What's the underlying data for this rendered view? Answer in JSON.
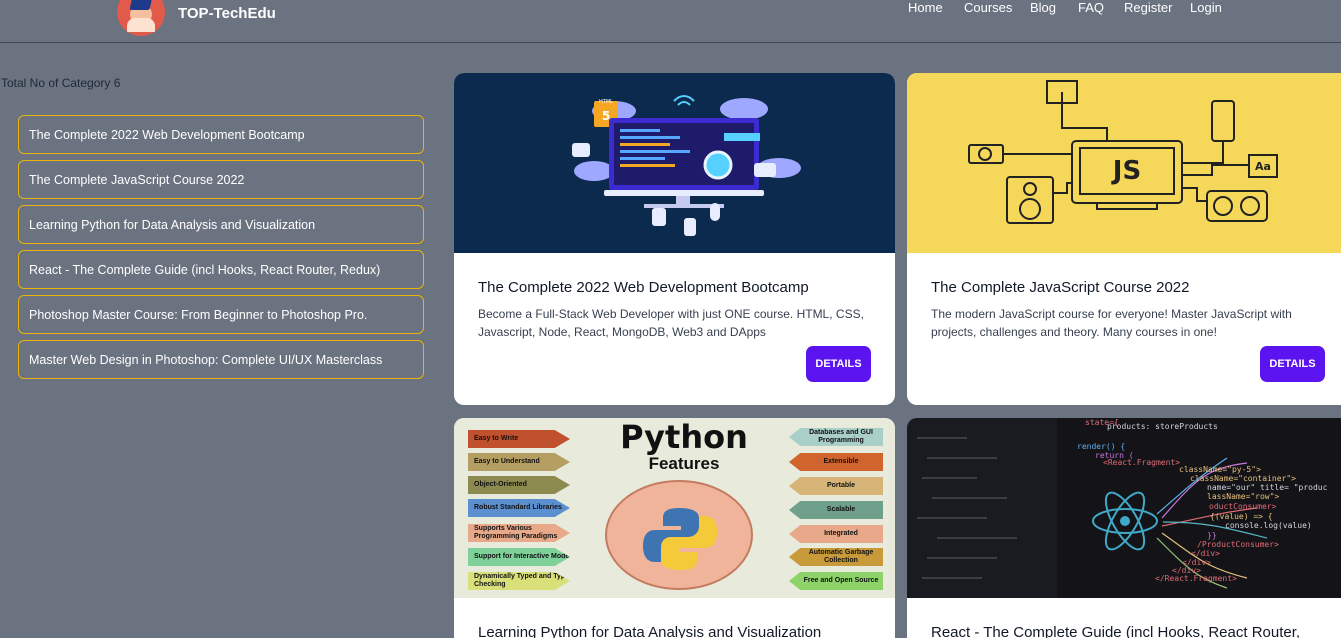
{
  "navbar": {
    "brand": "TOP-TechEdu",
    "links": [
      "Home",
      "Courses",
      "Blog",
      "FAQ",
      "Register",
      "Login"
    ]
  },
  "sidebar": {
    "count_label": "Total No of Category 6",
    "categories": [
      "The Complete 2022 Web Development Bootcamp",
      "The Complete JavaScript Course 2022",
      "Learning Python for Data Analysis and Visualization",
      "React - The Complete Guide (incl Hooks, React Router, Redux)",
      "Photoshop Master Course: From Beginner to Photoshop Pro.",
      "Master Web Design in Photoshop: Complete UI/UX Masterclass"
    ]
  },
  "cards": [
    {
      "title": "The Complete 2022 Web Development Bootcamp",
      "description": "Become a Full-Stack Web Developer with just ONE course. HTML, CSS, Javascript, Node, React, MongoDB, Web3 and DApps",
      "button": "DETAILS",
      "image_label": "HTML",
      "image_badge": "5"
    },
    {
      "title": "The Complete JavaScript Course 2022",
      "description": "The modern JavaScript course for everyone! Master JavaScript with projects, challenges and theory. Many courses in one!",
      "button": "DETAILS",
      "image_label": "JS",
      "image_badge": "Aa"
    },
    {
      "title": "Learning Python for Data Analysis and Visualization",
      "image_title": "Python",
      "image_subtitle": "Features",
      "features_left": [
        "Easy to Write",
        "Easy to Understand",
        "Object-Oriented",
        "Robust Standard Libraries",
        "Supports Various Programming Paradigms",
        "Support for Interactive Mode",
        "Dynamically Typed and Type Checking"
      ],
      "features_right": [
        "Databases and GUI Programming",
        "Extensible",
        "Portable",
        "Scalable",
        "Integrated",
        "Automatic Garbage Collection",
        "Free and Open Source"
      ]
    },
    {
      "title": "React - The Complete Guide (incl Hooks, React Router,",
      "code_lines": [
        "state={",
        "products: storeProducts",
        "render() {",
        "return (",
        "<React.Fragment>",
        "className=\"py-5\">",
        "className=\"container\">",
        "name=\"our\" title= \"produc",
        "lassName=\"row\">",
        "oductConsumer>",
        "{(value) => {",
        "console.log(value)",
        "}}",
        "/ProductConsumer>",
        "</div>",
        "</div>",
        "</div>",
        "</React.Fragment>"
      ]
    }
  ],
  "colors": {
    "background": "#6b7280",
    "button": "#5b14f0",
    "category_border": "#eab308",
    "card1_bg": "#0c2a4d",
    "card2_bg": "#f5d85a"
  }
}
